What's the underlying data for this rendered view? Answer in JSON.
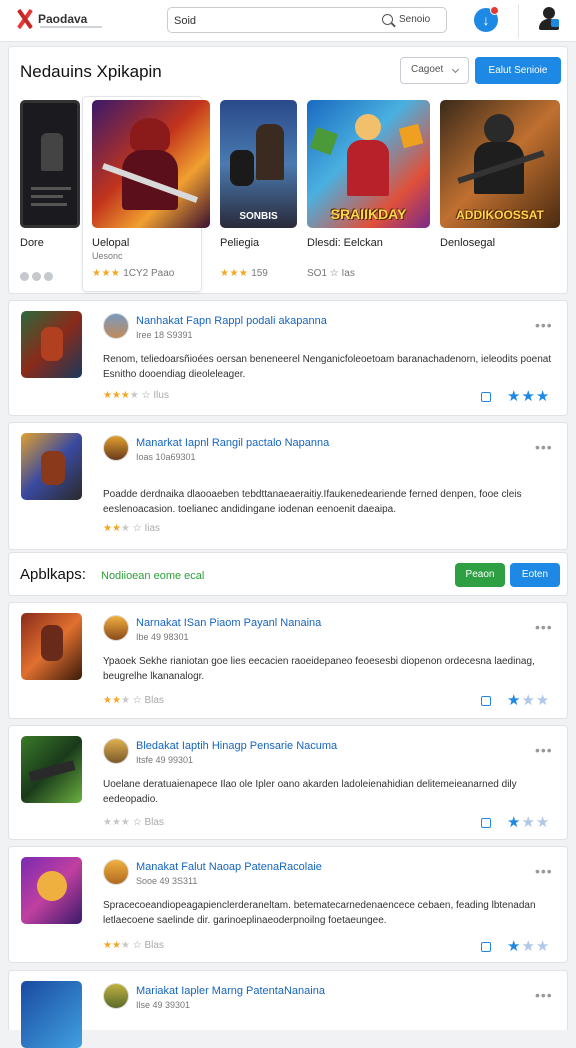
{
  "header": {
    "logo_text": "Paodava",
    "search_value": "Soid",
    "search_button": "Senoio"
  },
  "featured": {
    "title": "Nedauins Xpikapin",
    "category_select": "Cagoet",
    "primary_button": "Ealut Senioie",
    "items": [
      {
        "name": "Dore",
        "subtitle": "",
        "rating_text": "",
        "banner": ""
      },
      {
        "name": "Uelopal",
        "subtitle": "Uesonc",
        "stars": "★★★",
        "rating_text": "1CY2 Paao",
        "banner": ""
      },
      {
        "name": "Peliegia",
        "subtitle": "",
        "stars": "★★★",
        "rating_text": "159",
        "banner": "SONBIS"
      },
      {
        "name": "Dlesdi: Eelckan",
        "subtitle": "",
        "stars": "",
        "rating_text": "SO1 ☆ Ias",
        "banner": "SRAIIKDAY"
      },
      {
        "name": "Denlosegal",
        "subtitle": "",
        "stars": "",
        "rating_text": "",
        "banner": "ADDIKOOSSAT"
      }
    ]
  },
  "list_top": [
    {
      "title": "Nanhakat Fapn Rappl podali akapanna",
      "sub": "Iree 18 S9391",
      "desc": "Renom, teliedoarsñioées oersan beneneerel Nenganicfoleoetoam baranachadenorn, ieleodits poenat Esnitho dooendiag dieoleleager.",
      "stars_on": "★★★",
      "stars_off": "★",
      "rating_text": "Ilus",
      "blue_on": "★★★",
      "blue_off": ""
    },
    {
      "title": "Manarkat Iapnl Rangil pactalo Napanna",
      "sub": "Ioas 10a69301",
      "desc": "Poadde derdnaika dlaooaeben tebdttanaeaeraitiy.Ifaukenedeariende ferned denpen, fooe cleis eeslenoacasion. toelianec andidingane iodenan eenoenit daeaipa.",
      "stars_on": "★★",
      "stars_off": "★",
      "rating_text": "Iias",
      "blue_on": "",
      "blue_off": ""
    }
  ],
  "apps_section": {
    "title": "Apblkaps:",
    "tag": "Nodiioean eome ecal",
    "green_button": "Peaon",
    "blue_button": "Eoten"
  },
  "list_bottom": [
    {
      "title": "Narnakat ISan Piaom Payanl Nanaina",
      "sub": "Ibe 49 98301",
      "desc": "Ypaoek Sekhe rianiotan goe lies eecacien raoeidepaneo feoesesbi diopenon ordecesna laedinag, beugrelhe lkananalogr.",
      "stars_on": "★★",
      "stars_off": "★",
      "rating_text": "Blas",
      "blue_on": "★",
      "blue_off": "★★"
    },
    {
      "title": "Bledakat Iaptih Hinagp Pensarie Nacuma",
      "sub": "Itsfe 49 99301",
      "desc": "Uoelane deratuaienapece Ilao ole Ipler oano akarden ladoleienahidian delitemeieanarned dily eedeopadio.",
      "stars_on": "",
      "stars_off": "★★★",
      "rating_text": "Blas",
      "blue_on": "★",
      "blue_off": "★★"
    },
    {
      "title": "Manakat Falut Naoap PatenaRacolaie",
      "sub": "Sooe 49 3S311",
      "desc": "Spracecoeandiopeagapienclerderaneltam. betematecarnedenaencece cebaen, feading lbtenadan letlaecoene saelinde dir. garinoeplinaeoderpnoilng foetaeungee.",
      "stars_on": "★★",
      "stars_off": "★",
      "rating_text": "Blas",
      "blue_on": "★",
      "blue_off": "★★"
    },
    {
      "title": "Mariakat Iapler Marng PatentaNanaina",
      "sub": "Ilse 49 39301",
      "desc": "",
      "stars_on": "",
      "stars_off": "",
      "rating_text": "",
      "blue_on": "",
      "blue_off": ""
    }
  ],
  "colors": {
    "accent": "#1e88e5",
    "green": "#2ea043",
    "star": "#f5a623",
    "link": "#1565c0"
  }
}
